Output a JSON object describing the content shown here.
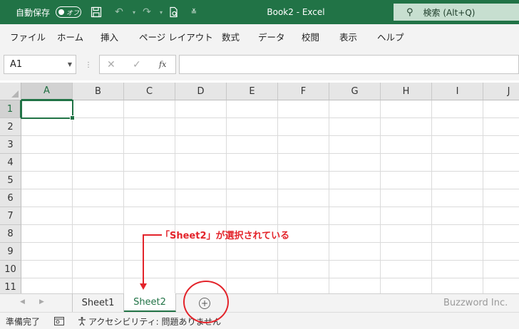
{
  "titlebar": {
    "autosave_label": "自動保存",
    "autosave_state": "オフ",
    "window_title": "Book2  -  Excel",
    "search_label": "検索 (Alt+Q)",
    "accent_color": "#217346"
  },
  "menu": [
    "ファイル",
    "ホーム",
    "挿入",
    "ページ レイアウト",
    "数式",
    "データ",
    "校閲",
    "表示",
    "ヘルプ"
  ],
  "formula_bar": {
    "name_box": "A1",
    "formula_value": ""
  },
  "grid": {
    "columns": [
      "A",
      "B",
      "C",
      "D",
      "E",
      "F",
      "G",
      "H",
      "I",
      "J"
    ],
    "rows": [
      "1",
      "2",
      "3",
      "4",
      "5",
      "6",
      "7",
      "8",
      "9",
      "10",
      "11"
    ],
    "active_cell": "A1"
  },
  "annotation": {
    "text": "「Sheet2」が選択されている",
    "color": "#e3242b"
  },
  "sheets": {
    "tabs": [
      "Sheet1",
      "Sheet2"
    ],
    "active": "Sheet2",
    "add_symbol": "+"
  },
  "watermark": "Buzzword Inc.",
  "status": {
    "ready": "準備完了",
    "accessibility": "アクセシビリティ: 問題ありません"
  }
}
